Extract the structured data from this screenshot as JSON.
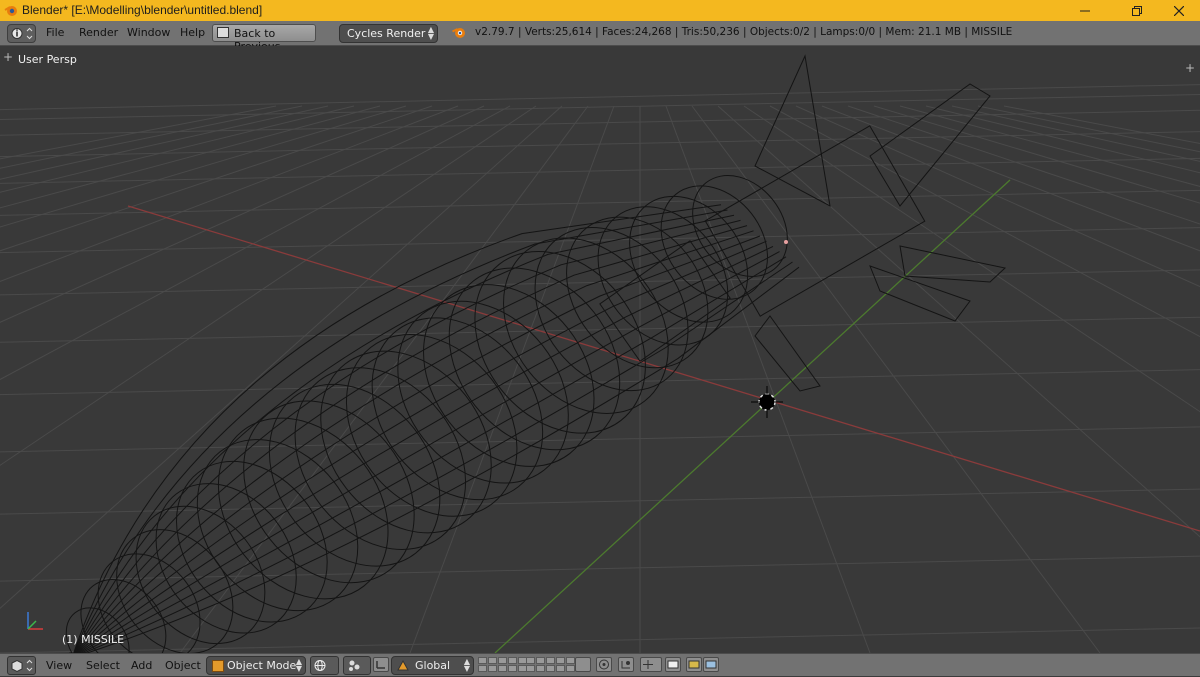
{
  "window": {
    "title": "Blender* [E:\\Modelling\\blender\\untitled.blend]",
    "accent_color": "#f4b81f"
  },
  "info_header": {
    "menu": [
      "File",
      "Render",
      "Window",
      "Help"
    ],
    "back_button": "Back to Previous",
    "render_engine": "Cycles Render",
    "stats": "v2.79.7 | Verts:25,614 | Faces:24,268 | Tris:50,236 | Objects:0/2 | Lamps:0/0 | Mem: 21.1 MB | MISSILE"
  },
  "viewport": {
    "view_name": "User Persp",
    "object_label": "(1) MISSILE",
    "background_color": "#393939"
  },
  "view3d_header": {
    "menu": [
      "View",
      "Select",
      "Add",
      "Object"
    ],
    "mode": "Object Mode",
    "orientation": "Global"
  },
  "icons": [
    "blender-icon",
    "minimize-icon",
    "restore-icon",
    "close-icon",
    "info-editor-icon",
    "back-icon",
    "blender-logo-icon",
    "view3d-editor-icon",
    "object-mode-icon",
    "viewport-shading-icon",
    "pivot-icon",
    "manipulator-icon",
    "layers-icon",
    "lock-layers-icon",
    "render-icon",
    "proportional-edit-icon",
    "snap-icon",
    "opengl-render-icon"
  ]
}
